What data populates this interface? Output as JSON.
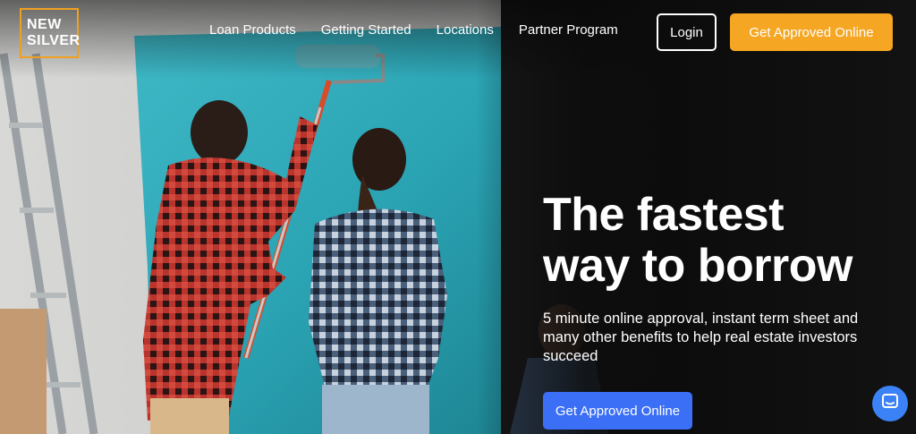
{
  "brand": {
    "logo_line1": "NEW",
    "logo_line2": "SILVER",
    "accent_color": "#f5a623",
    "primary_color": "#3b6ff5"
  },
  "nav": {
    "items": [
      {
        "label": "Loan Products"
      },
      {
        "label": "Getting Started"
      },
      {
        "label": "Locations"
      },
      {
        "label": "Partner Program"
      }
    ],
    "login_label": "Login",
    "cta_label": "Get Approved Online"
  },
  "hero": {
    "headline_line1": "The fastest",
    "headline_line2": "way to borrow",
    "subtext": "5 minute online approval, instant term sheet and many other benefits to help real estate investors succeed",
    "cta_label": "Get Approved Online",
    "image_description_icon": "photo-couple-painting-wall"
  },
  "chat": {
    "icon": "chat-bubble-icon"
  }
}
